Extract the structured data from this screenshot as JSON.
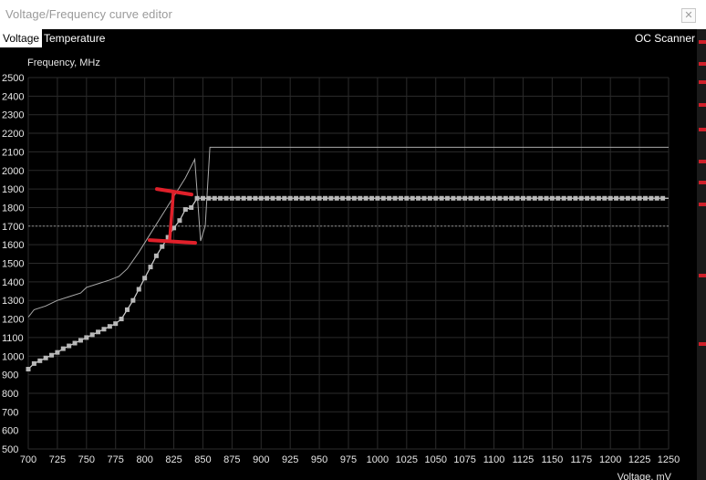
{
  "window": {
    "title": "Voltage/Frequency curve editor",
    "close_icon": "close-icon",
    "background_app_text": ""
  },
  "tabs": [
    {
      "label": "Voltage",
      "active": true
    },
    {
      "label": "Temperature",
      "active": false
    }
  ],
  "oc_scanner_label": "OC Scanner",
  "colors": {
    "background": "#000000",
    "grid": "#2b2b2b",
    "curve_points": "#b8b8b8",
    "reference_line": "#aaaaaa",
    "annotation": "#e0202a",
    "side_marks": "#d0202a"
  },
  "chart_data": {
    "type": "line",
    "xlabel": "Voltage, mV",
    "ylabel": "Frequency, MHz",
    "xlim": [
      700,
      1250
    ],
    "ylim": [
      500,
      2500
    ],
    "x_ticks": [
      "700",
      "725",
      "750",
      "775",
      "800",
      "825",
      "850",
      "875",
      "900",
      "925",
      "950",
      "975",
      "1000",
      "1025",
      "1050",
      "1075",
      "1100",
      "1125",
      "1150",
      "1175",
      "1200",
      "1225",
      "1250"
    ],
    "y_ticks": [
      "500",
      "600",
      "700",
      "800",
      "900",
      "1000",
      "1100",
      "1200",
      "1300",
      "1400",
      "1500",
      "1600",
      "1700",
      "1800",
      "1900",
      "2000",
      "2100",
      "2200",
      "2300",
      "2400",
      "2500"
    ],
    "grid": true,
    "limit_line_mhz": 1700,
    "series": [
      {
        "style": "line",
        "points": [
          [
            700,
            1210
          ],
          [
            705,
            1250
          ],
          [
            715,
            1270
          ],
          [
            725,
            1300
          ],
          [
            735,
            1320
          ],
          [
            745,
            1340
          ],
          [
            750,
            1370
          ],
          [
            760,
            1390
          ],
          [
            770,
            1410
          ],
          [
            778,
            1430
          ],
          [
            785,
            1470
          ],
          [
            795,
            1560
          ],
          [
            805,
            1660
          ],
          [
            815,
            1760
          ],
          [
            825,
            1860
          ],
          [
            835,
            1960
          ],
          [
            843,
            2060
          ],
          [
            848,
            1620
          ],
          [
            852,
            1700
          ],
          [
            856,
            2125
          ],
          [
            860,
            2125
          ],
          [
            1250,
            2125
          ]
        ]
      },
      {
        "style": "line-with-points",
        "points": [
          [
            700,
            930
          ],
          [
            705,
            960
          ],
          [
            710,
            975
          ],
          [
            715,
            990
          ],
          [
            720,
            1005
          ],
          [
            725,
            1020
          ],
          [
            730,
            1040
          ],
          [
            735,
            1055
          ],
          [
            740,
            1070
          ],
          [
            745,
            1085
          ],
          [
            750,
            1100
          ],
          [
            755,
            1115
          ],
          [
            760,
            1130
          ],
          [
            765,
            1145
          ],
          [
            770,
            1160
          ],
          [
            775,
            1175
          ],
          [
            780,
            1200
          ],
          [
            785,
            1250
          ],
          [
            790,
            1300
          ],
          [
            795,
            1360
          ],
          [
            800,
            1420
          ],
          [
            805,
            1480
          ],
          [
            810,
            1540
          ],
          [
            815,
            1590
          ],
          [
            820,
            1640
          ],
          [
            825,
            1690
          ],
          [
            830,
            1730
          ],
          [
            835,
            1790
          ],
          [
            840,
            1800
          ],
          [
            845,
            1850
          ],
          [
            850,
            1850
          ],
          [
            1250,
            1850
          ]
        ]
      }
    ],
    "annotations": [
      {
        "type": "bracket",
        "x": 823,
        "y_from": 1615,
        "y_to": 1885
      }
    ]
  }
}
